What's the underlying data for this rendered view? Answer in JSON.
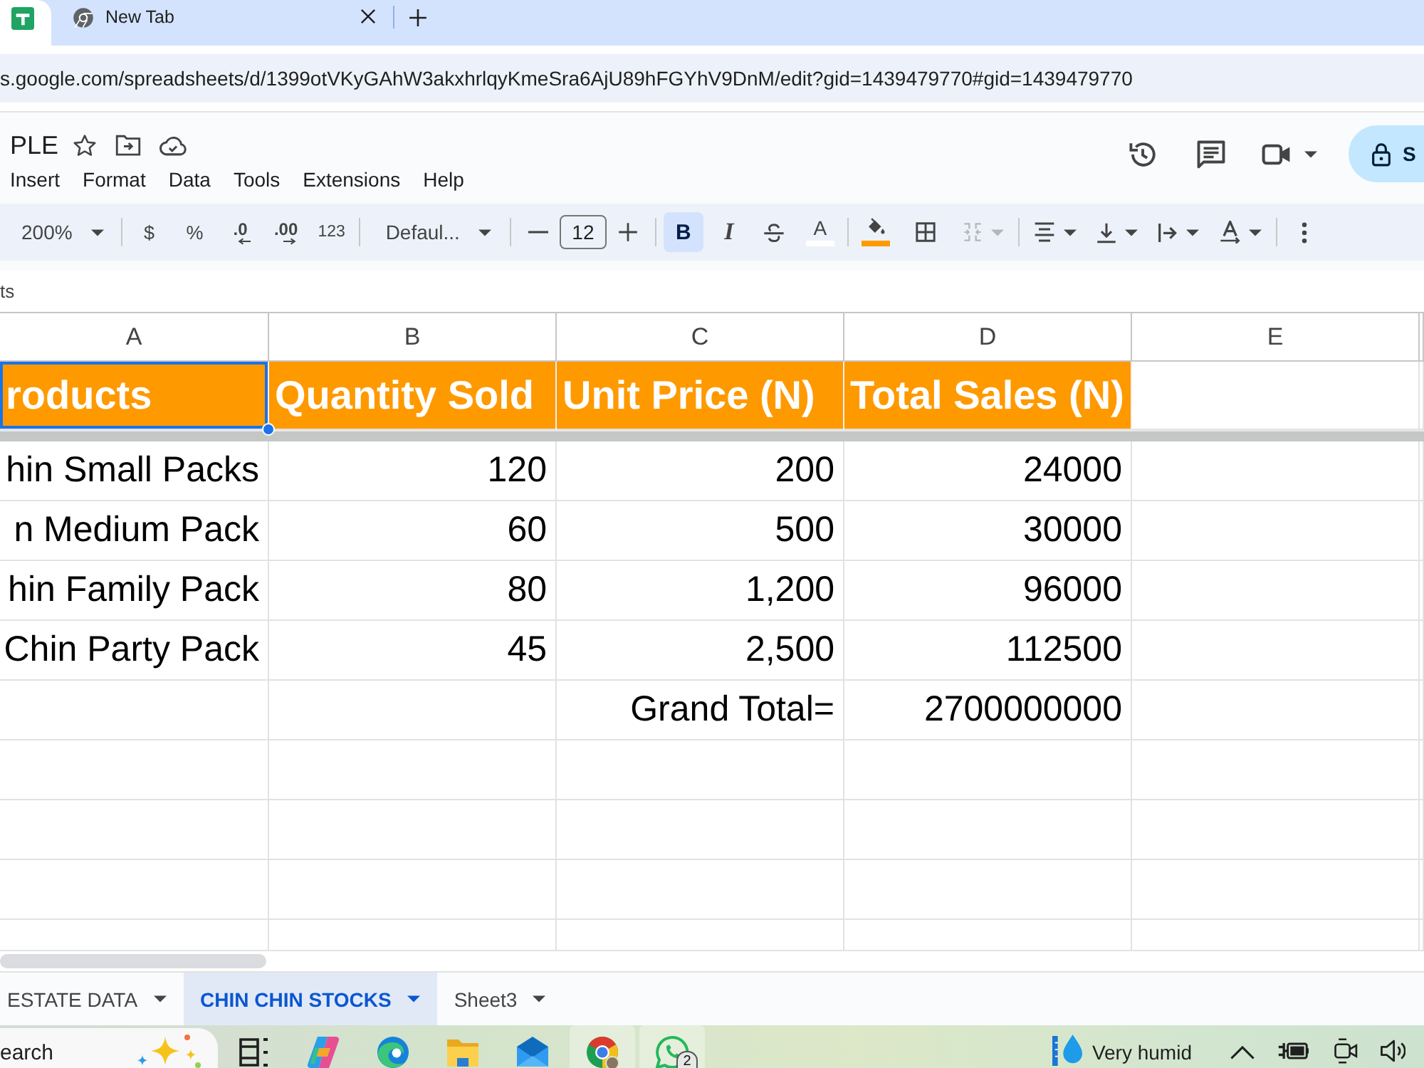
{
  "browser": {
    "tabs": [
      {
        "kind": "sheets",
        "selected": true
      },
      {
        "kind": "new-tab",
        "label": "New Tab",
        "selected": false
      }
    ],
    "url": "s.google.com/spreadsheets/d/1399otVKyGAhW3akxhrlqyKmeSra6AjU89hFGYhV9DnM/edit?gid=1439479770#gid=1439479770"
  },
  "document": {
    "title": "PLE",
    "menu": [
      "Insert",
      "Format",
      "Data",
      "Tools",
      "Extensions",
      "Help"
    ],
    "share_label": "S"
  },
  "toolbar": {
    "groups": [
      [
        {
          "kind": "zoom",
          "label": "200%",
          "disabled": false
        }
      ],
      [
        {
          "kind": "currency",
          "label": "$",
          "disabled": false
        },
        {
          "kind": "percent",
          "label": "%",
          "disabled": false
        },
        {
          "kind": "decrease-decimal",
          "label": ".0",
          "disabled": false
        },
        {
          "kind": "increase-decimal",
          "label": ".00",
          "disabled": false
        },
        {
          "kind": "number-format",
          "label": "123",
          "disabled": false
        }
      ],
      [
        {
          "kind": "font",
          "label": "Defaul...",
          "disabled": false
        }
      ],
      [
        {
          "kind": "font-size-decrease",
          "disabled": false
        },
        {
          "kind": "font-size",
          "value": "12",
          "disabled": false
        },
        {
          "kind": "font-size-increase",
          "disabled": false
        }
      ],
      [
        {
          "kind": "bold",
          "label": "B",
          "selected": true,
          "disabled": false
        },
        {
          "kind": "italic",
          "label": "I",
          "selected": false,
          "disabled": false
        },
        {
          "kind": "strikethrough",
          "selected": false,
          "disabled": false
        },
        {
          "kind": "text-color",
          "label": "A",
          "color": "#ffffff",
          "disabled": false
        }
      ],
      [
        {
          "kind": "fill-color",
          "color": "#ff9900",
          "disabled": false
        },
        {
          "kind": "borders",
          "disabled": false
        },
        {
          "kind": "merge",
          "disabled": true
        }
      ],
      [
        {
          "kind": "align",
          "disabled": false
        },
        {
          "kind": "valign",
          "disabled": false
        },
        {
          "kind": "wrap",
          "disabled": false
        },
        {
          "kind": "rotate",
          "disabled": false
        }
      ],
      [
        {
          "kind": "more",
          "disabled": false
        }
      ]
    ]
  },
  "formula_bar": {
    "value": "ts"
  },
  "sheet": {
    "columns": [
      "A",
      "B",
      "C",
      "D",
      "E"
    ],
    "rows": [
      {
        "kind": "header",
        "cells": [
          {
            "text": "roducts",
            "selected": true
          },
          {
            "text": "Quantity Sold",
            "selected": false
          },
          {
            "text": "Unit Price (N)",
            "selected": false
          },
          {
            "text": "Total Sales (N)",
            "selected": false
          }
        ]
      },
      {
        "kind": "data",
        "cells": [
          {
            "text": "hin Small Packs",
            "selected": false
          },
          {
            "text": "120",
            "selected": false
          },
          {
            "text": "200",
            "selected": false
          },
          {
            "text": "24000",
            "selected": false
          }
        ]
      },
      {
        "kind": "data",
        "cells": [
          {
            "text": "n Medium Pack",
            "selected": false
          },
          {
            "text": "60",
            "selected": false
          },
          {
            "text": "500",
            "selected": false
          },
          {
            "text": "30000",
            "selected": false
          }
        ]
      },
      {
        "kind": "data",
        "cells": [
          {
            "text": "hin Family Pack",
            "selected": false
          },
          {
            "text": "80",
            "selected": false
          },
          {
            "text": "1,200",
            "selected": false
          },
          {
            "text": "96000",
            "selected": false
          }
        ]
      },
      {
        "kind": "data",
        "cells": [
          {
            "text": "Chin Party Pack",
            "selected": false
          },
          {
            "text": "45",
            "selected": false
          },
          {
            "text": "2,500",
            "selected": false
          },
          {
            "text": "112500",
            "selected": false
          }
        ]
      },
      {
        "kind": "data",
        "cells": [
          {
            "text": "",
            "selected": false
          },
          {
            "text": "",
            "selected": false
          },
          {
            "text": "Grand Total=",
            "selected": false
          },
          {
            "text": "2700000000",
            "selected": false
          }
        ]
      }
    ]
  },
  "sheet_tabs": [
    {
      "label": "ESTATE DATA",
      "selected": false
    },
    {
      "label": "CHIN CHIN STOCKS",
      "selected": true
    },
    {
      "label": "Sheet3",
      "selected": false
    }
  ],
  "taskbar": {
    "search": {
      "placeholder": "earch"
    },
    "apps": [
      {
        "kind": "task-view",
        "selected": false
      },
      {
        "kind": "copilot",
        "selected": false
      },
      {
        "kind": "edge",
        "selected": false
      },
      {
        "kind": "files",
        "selected": false
      },
      {
        "kind": "mail",
        "selected": false
      },
      {
        "kind": "chrome",
        "selected": true
      },
      {
        "kind": "whatsapp",
        "selected": true,
        "badge": "2"
      }
    ],
    "weather": "Very humid"
  }
}
